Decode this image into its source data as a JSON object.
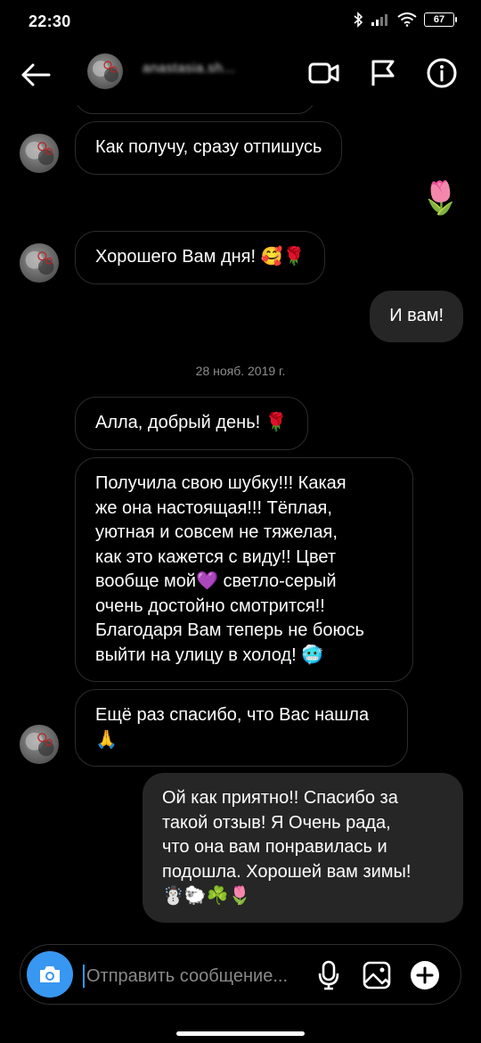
{
  "status_bar": {
    "time": "22:30",
    "battery": "67"
  },
  "header": {
    "contact_name": "anastasia.sh...",
    "icons": [
      "back-arrow-icon",
      "video-call-icon",
      "flag-icon",
      "info-icon"
    ]
  },
  "messages": [
    {
      "side": "in",
      "text": "Как получу, сразу отпишусь"
    },
    {
      "side": "out",
      "text": "🌷"
    },
    {
      "side": "in",
      "text": "Хорошего Вам дня! 🥰🌹"
    },
    {
      "side": "out",
      "text": "И вам!"
    },
    {
      "side": "in",
      "text": "Алла, добрый день! 🌹"
    },
    {
      "side": "in",
      "text": "Получила свою шубку!!! Какая\nже она настоящая!!! Тёплая,\nуютная и совсем не тяжелая,\nкак это кажется с виду!! Цвет\nвообще мой💜 светло-серый\nочень достойно смотрится!!\nБлагодаря Вам теперь не боюсь\nвыйти на улицу в холод! 🥶"
    },
    {
      "side": "in",
      "text": "Ещё раз спасибо, что Вас нашла\n🙏"
    },
    {
      "side": "out",
      "text": "Ой как приятно!! Спасибо за\nтакой отзыв! Я Очень рада,\nчто она вам понравилась и\nподошла. Хорошей вам зимы!\n☃️🐑☘️🌷"
    }
  ],
  "date_separator": "28 нояб. 2019 г.",
  "composer": {
    "placeholder": "Отправить сообщение...",
    "icons": [
      "camera-icon",
      "microphone-icon",
      "gallery-icon",
      "plus-icon"
    ]
  },
  "colors": {
    "background": "#000000",
    "outgoing_bubble": "#262626",
    "incoming_border": "#2b2b2b",
    "accent": "#3897f0",
    "meta_text": "#8e8e8e"
  }
}
